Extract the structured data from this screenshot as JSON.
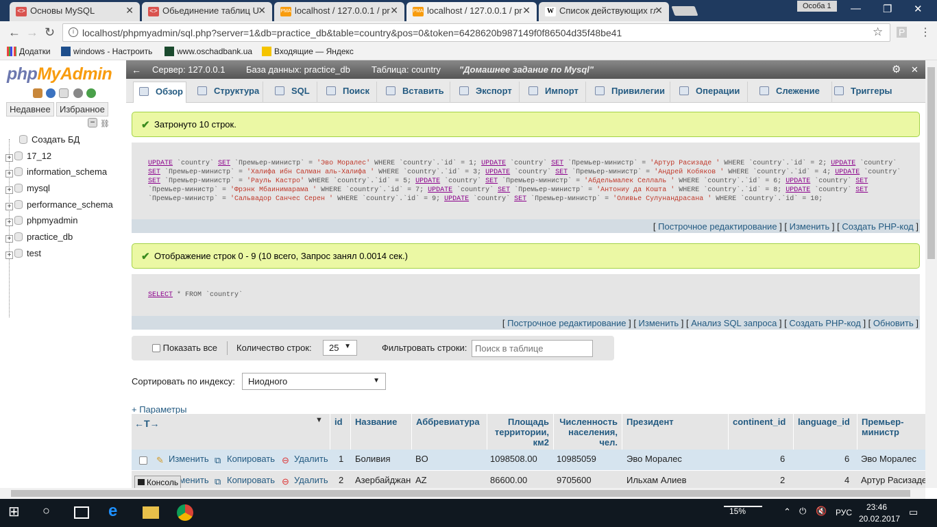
{
  "browser": {
    "tabs": [
      {
        "label": "Основы MySQL",
        "icon": "code-icon"
      },
      {
        "label": "Обьединение таблиц UI",
        "icon": "code-icon"
      },
      {
        "label": "localhost / 127.0.0.1 / pr",
        "icon": "phpmyadmin-icon"
      },
      {
        "label": "localhost / 127.0.0.1 / pr",
        "icon": "phpmyadmin-icon",
        "active": true
      },
      {
        "label": "Список действующих гл",
        "icon": "wikipedia-icon"
      }
    ],
    "profile": "Особа 1",
    "url": "localhost/phpmyadmin/sql.php?server=1&db=practice_db&table=country&pos=0&token=6428620b987149f0f86504d35f48be41",
    "bookmarks": [
      "Додатки",
      "windows - Настроить",
      "www.oschadbank.ua",
      "Входящие — Яндекс"
    ]
  },
  "sidebar": {
    "logo_a": "php",
    "logo_b": "MyAdmin",
    "tab_recent": "Недавнее",
    "tab_favorites": "Избранное",
    "create_db": "Создать БД",
    "databases": [
      "17_12",
      "information_schema",
      "mysql",
      "performance_schema",
      "phpmyadmin",
      "practice_db",
      "test"
    ]
  },
  "topbar": {
    "server": "Сервер: 127.0.0.1",
    "database": "База данных: practice_db",
    "table": "Таблица: country",
    "comment": "\"Домашнее задание по Mysql\""
  },
  "tabs": [
    "Обзор",
    "Структура",
    "SQL",
    "Поиск",
    "Вставить",
    "Экспорт",
    "Импорт",
    "Привилегии",
    "Операции",
    "Слежение",
    "Триггеры"
  ],
  "update_msg": "Затронуто 10 строк.",
  "update_sql": [
    {
      "t": "k",
      "v": "UPDATE"
    },
    {
      "t": "p",
      "v": " `country` "
    },
    {
      "t": "k",
      "v": "SET"
    },
    {
      "t": "p",
      "v": " `Премьер-министр` = "
    },
    {
      "t": "s",
      "v": "'Эво Моралес'"
    },
    {
      "t": "p",
      "v": " WHERE `country`.`id` = 1; "
    },
    {
      "t": "k",
      "v": "UPDATE"
    },
    {
      "t": "p",
      "v": " `country` "
    },
    {
      "t": "k",
      "v": "SET"
    },
    {
      "t": "p",
      "v": " `Премьер-министр` = "
    },
    {
      "t": "s",
      "v": "'Артур Расизаде '"
    },
    {
      "t": "p",
      "v": " WHERE `country`.`id` = 2; "
    },
    {
      "t": "k",
      "v": "UPDATE"
    },
    {
      "t": "p",
      "v": " `country` "
    },
    {
      "t": "k",
      "v": "SET"
    },
    {
      "t": "p",
      "v": " `Премьер-министр` = "
    },
    {
      "t": "s",
      "v": "'Халифа ибн Салман аль-Халифа '"
    },
    {
      "t": "p",
      "v": " WHERE `country`.`id` = 3; "
    },
    {
      "t": "k",
      "v": "UPDATE"
    },
    {
      "t": "p",
      "v": " `country` "
    },
    {
      "t": "k",
      "v": "SET"
    },
    {
      "t": "p",
      "v": " `Премьер-министр` = "
    },
    {
      "t": "s",
      "v": "'Андрей Кобяков '"
    },
    {
      "t": "p",
      "v": " WHERE `country`.`id` = 4; "
    },
    {
      "t": "k",
      "v": "UPDATE"
    },
    {
      "t": "p",
      "v": " `country` "
    },
    {
      "t": "k",
      "v": "SET"
    },
    {
      "t": "p",
      "v": " `Премьер-министр` = "
    },
    {
      "t": "s",
      "v": "'Рауль Кастро'"
    },
    {
      "t": "p",
      "v": " WHERE `country`.`id` = 5; "
    },
    {
      "t": "k",
      "v": "UPDATE"
    },
    {
      "t": "p",
      "v": " `country` "
    },
    {
      "t": "k",
      "v": "SET"
    },
    {
      "t": "p",
      "v": " `Премьер-министр` = "
    },
    {
      "t": "s",
      "v": "'Абдельмалек Селлаль '"
    },
    {
      "t": "p",
      "v": " WHERE `country`.`id` = 6; "
    },
    {
      "t": "k",
      "v": "UPDATE"
    },
    {
      "t": "p",
      "v": " `country` "
    },
    {
      "t": "k",
      "v": "SET"
    },
    {
      "t": "p",
      "v": " `Премьер-министр` = "
    },
    {
      "t": "s",
      "v": "'Фрэнк Мбаинимарама '"
    },
    {
      "t": "p",
      "v": " WHERE `country`.`id` = 7; "
    },
    {
      "t": "k",
      "v": "UPDATE"
    },
    {
      "t": "p",
      "v": " `country` "
    },
    {
      "t": "k",
      "v": "SET"
    },
    {
      "t": "p",
      "v": " `Премьер-министр` = "
    },
    {
      "t": "s",
      "v": "'Антониу да Кошта '"
    },
    {
      "t": "p",
      "v": " WHERE `country`.`id` = 8; "
    },
    {
      "t": "k",
      "v": "UPDATE"
    },
    {
      "t": "p",
      "v": " `country` "
    },
    {
      "t": "k",
      "v": "SET"
    },
    {
      "t": "p",
      "v": " `Премьер-министр` = "
    },
    {
      "t": "s",
      "v": "'Сальвадор Санчес Серен '"
    },
    {
      "t": "p",
      "v": " WHERE `country`.`id` = 9; "
    },
    {
      "t": "k",
      "v": "UPDATE"
    },
    {
      "t": "p",
      "v": " `country` "
    },
    {
      "t": "k",
      "v": "SET"
    },
    {
      "t": "p",
      "v": " `Премьер-министр` = "
    },
    {
      "t": "s",
      "v": "'Оливье Сулунандрасана '"
    },
    {
      "t": "p",
      "v": " WHERE `country`.`id` = 10;"
    }
  ],
  "links1": {
    "inline": "Построчное редактирование",
    "edit": "Изменить",
    "php": "Создать PHP-код"
  },
  "select_msg": "Отображение строк 0 - 9 (10 всего, Запрос занял 0.0014 сек.)",
  "select_sql": {
    "kw": "SELECT",
    "rest": " * FROM `country`"
  },
  "links2": {
    "inline": "Построчное редактирование",
    "edit": "Изменить",
    "analyze": "Анализ SQL запроса",
    "php": "Создать PHP-код",
    "refresh": "Обновить"
  },
  "nav": {
    "show_all": "Показать все",
    "rows_label": "Количество строк:",
    "rows_value": "25",
    "filter_label": "Фильтровать строки:",
    "filter_placeholder": "Поиск в таблице"
  },
  "sort": {
    "label": "Сортировать по индексу:",
    "value": "Ниодного"
  },
  "params": "+ Параметры",
  "columns": [
    "id",
    "Название",
    "Аббревиатура",
    "Площадь территории, км2",
    "Численность населения, чел.",
    "Президент",
    "continent_id",
    "language_id",
    "Премьер-министр"
  ],
  "actions": {
    "edit": "Изменить",
    "copy": "Копировать",
    "delete": "Удалить"
  },
  "rows": [
    {
      "id": "1",
      "name": "Боливия",
      "abbr": "BO",
      "area": "1098508.00",
      "pop": "10985059",
      "president": "Эво Моралес",
      "continent": "6",
      "language": "6",
      "pm": "Эво Моралес"
    },
    {
      "id": "2",
      "name": "Азербайджан",
      "abbr": "AZ",
      "area": "86600.00",
      "pop": "9705600",
      "president": "Ильхам Алиев",
      "continent": "2",
      "language": "4",
      "pm": "Артур Расизаде"
    }
  ],
  "console": "Консоль",
  "taskbar": {
    "battery": "15%",
    "lang": "РУС",
    "time": "23:46",
    "date": "20.02.2017"
  }
}
